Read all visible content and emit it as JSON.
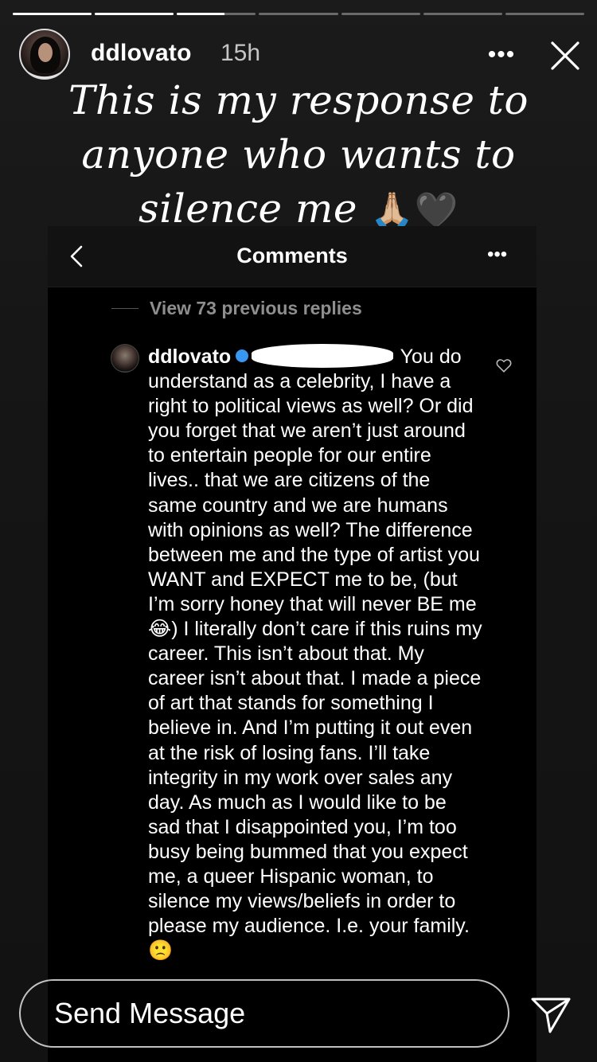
{
  "story": {
    "progress": [
      1,
      1,
      0.6,
      0,
      0,
      0,
      0
    ],
    "username": "ddlovato",
    "time_ago": "15h",
    "more_label": "•••",
    "caption_text": "This is my response to anyone who wants to silence me",
    "caption_emoji": "🙏🏼🖤"
  },
  "screenshot": {
    "title": "Comments",
    "more_label": "•••",
    "view_replies": "View 73 previous replies",
    "comment": {
      "username": "ddlovato",
      "text_start": "You",
      "text_body": "do understand as a celebrity, I have a right to political views as well? Or did you forget that we aren’t just around to entertain people for our entire  lives.. that we are citizens of the same country and we are humans with opinions as well? The difference between me and the type of artist you WANT and EXPECT me to be, (but I’m sorry honey that will never BE me 😂) I literally don’t care if this ruins my career. This isn’t about that. My career isn’t about that. I made a piece of art that stands for something I believe in. And I’m putting it out even at the risk of losing fans. I’ll take integrity in my work over sales any day. As much as I would like to be sad that I disappointed you, I’m too busy being bummed that you expect me, a queer Hispanic woman, to silence my views/beliefs in order to please my audience. I.e. your family. 🙁"
    }
  },
  "reply_bar": {
    "placeholder": "Send Message"
  }
}
